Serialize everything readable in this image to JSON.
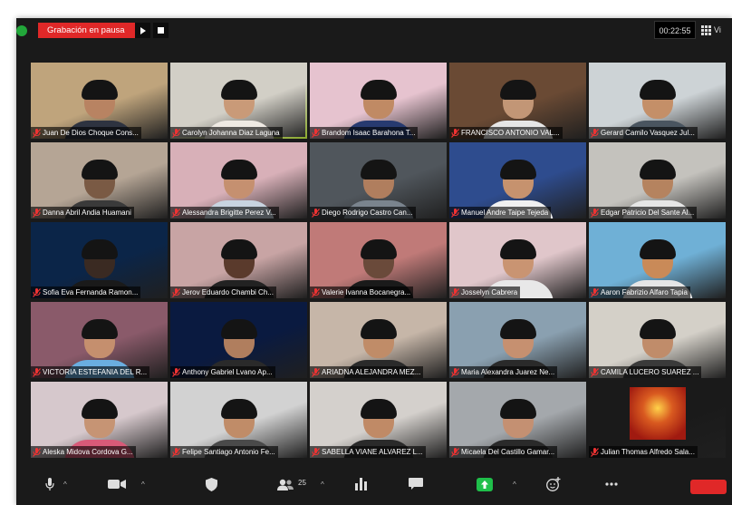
{
  "recording": {
    "status_label": "Grabación en pausa"
  },
  "meeting": {
    "timer": "00:22:55",
    "view_label": "Vi"
  },
  "participants": [
    {
      "name": "Juan De Dios Choque Cons...",
      "bg": "#bfa47c",
      "skin": "#b88362",
      "shirt": "#2e3340",
      "active": false
    },
    {
      "name": "Carolyn Johanna Diaz Laguna",
      "bg": "#d2cfc6",
      "skin": "#c99a78",
      "shirt": "#efeae3",
      "active": true
    },
    {
      "name": "Brandom Isaac Barahona T...",
      "bg": "#e6c3cf",
      "skin": "#c08a64",
      "shirt": "#273a70",
      "active": false
    },
    {
      "name": "FRANCISCO ANTONIO VAL...",
      "bg": "#6a4a34",
      "skin": "#c29676",
      "shirt": "#e6e6e6",
      "active": false
    },
    {
      "name": "Gerard Camilo Vasquez Jul...",
      "bg": "#cdd3d6",
      "skin": "#c48f68",
      "shirt": "#4a5560",
      "active": false
    },
    {
      "name": "Danna Abril Andia Huamani",
      "bg": "#b5a595",
      "skin": "#7a5a44",
      "shirt": "#3a3a3a",
      "active": false
    },
    {
      "name": "Alessandra Brigitte Perez V...",
      "bg": "#d8b0b8",
      "skin": "#c59070",
      "shirt": "#c8d4e0",
      "active": false
    },
    {
      "name": "Diego Rodrigo Castro Can...",
      "bg": "#50565c",
      "skin": "#b07e5e",
      "shirt": "#7a848e",
      "active": false
    },
    {
      "name": "Manuel Andre Taipe Tejeda",
      "bg": "#2e4c8e",
      "skin": "#c6926e",
      "shirt": "#f0f0f0",
      "active": false
    },
    {
      "name": "Edgar Patricio Del Sante Al...",
      "bg": "#c4c2bd",
      "skin": "#b5835f",
      "shirt": "#e6e6e6",
      "active": false
    },
    {
      "name": "Sofia Eva Fernanda Ramon...",
      "bg": "#0b2548",
      "skin": "#3a2a22",
      "shirt": "#1a1a1a",
      "active": false
    },
    {
      "name": "Jerov Eduardo Chambi Ch...",
      "bg": "#c8a4a4",
      "skin": "#5a3a2c",
      "shirt": "#222222",
      "active": false
    },
    {
      "name": "Valerie Ivanna Bocanegra...",
      "bg": "#c07a78",
      "skin": "#6a4a3a",
      "shirt": "#1a1a1a",
      "active": false
    },
    {
      "name": "Josselyn Cabrera",
      "bg": "#e0c6ca",
      "skin": "#c99472",
      "shirt": "#e8e8e8",
      "active": false
    },
    {
      "name": "Aaron Fabrizio Alfaro Tapia",
      "bg": "#6fb0d6",
      "skin": "#c98a58",
      "shirt": "#e6e6e6",
      "active": false
    },
    {
      "name": "VICTORIA ESTEFANIA DEL R...",
      "bg": "#8a5a6a",
      "skin": "#c58f6e",
      "shirt": "#6aaee0",
      "active": false
    },
    {
      "name": "Anthony Gabriel Lvano Ap...",
      "bg": "#0a1a40",
      "skin": "#b07e5e",
      "shirt": "#2a2a2a",
      "active": false
    },
    {
      "name": "ARIADNA ALEJANDRA MEZ...",
      "bg": "#c6b6a8",
      "skin": "#c08c68",
      "shirt": "#2a2a2a",
      "active": false
    },
    {
      "name": "Maria Alexandra Juarez Ne...",
      "bg": "#8aa0b0",
      "skin": "#c69070",
      "shirt": "#2a2a2a",
      "active": false
    },
    {
      "name": "CAMILA LUCERO SUAREZ ...",
      "bg": "#d4d0c8",
      "skin": "#c08c6a",
      "shirt": "#3a3a3a",
      "active": false
    },
    {
      "name": "Aleska Midova Cordova G...",
      "bg": "#d6c8cc",
      "skin": "#c69474",
      "shirt": "#d85a78",
      "active": false
    },
    {
      "name": "Felipe Santiago Antonio Fe...",
      "bg": "#d2d2d2",
      "skin": "#c08c68",
      "shirt": "#4a4a4a",
      "active": false
    },
    {
      "name": "SABELLA VIANE ALVAREZ L...",
      "bg": "#d4d0cc",
      "skin": "#c08a66",
      "shirt": "#2a2a2a",
      "active": false
    },
    {
      "name": "Micaela Del Castillo Gamar...",
      "bg": "#a4a8ac",
      "skin": "#c49072",
      "shirt": "#2a2a2a",
      "active": false
    },
    {
      "name": "Julian Thomas Alfredo Sala...",
      "bg": "#1a1a1a",
      "skin": "#d95a20",
      "shirt": "#a01a10",
      "active": false,
      "avatar_image": true
    }
  ],
  "toolbar": {
    "participants_count": "25",
    "items": [
      "microphone-icon",
      "video-camera-icon",
      "security-shield-icon",
      "participants-icon",
      "poll-chart-icon",
      "chat-icon",
      "share-screen-icon",
      "reactions-icon",
      "more-icon"
    ]
  },
  "colors": {
    "recording_red": "#e02828",
    "active_speaker": "#b9e23c",
    "share_green": "#1fbf4a",
    "window_bg": "#1a1a1a"
  }
}
